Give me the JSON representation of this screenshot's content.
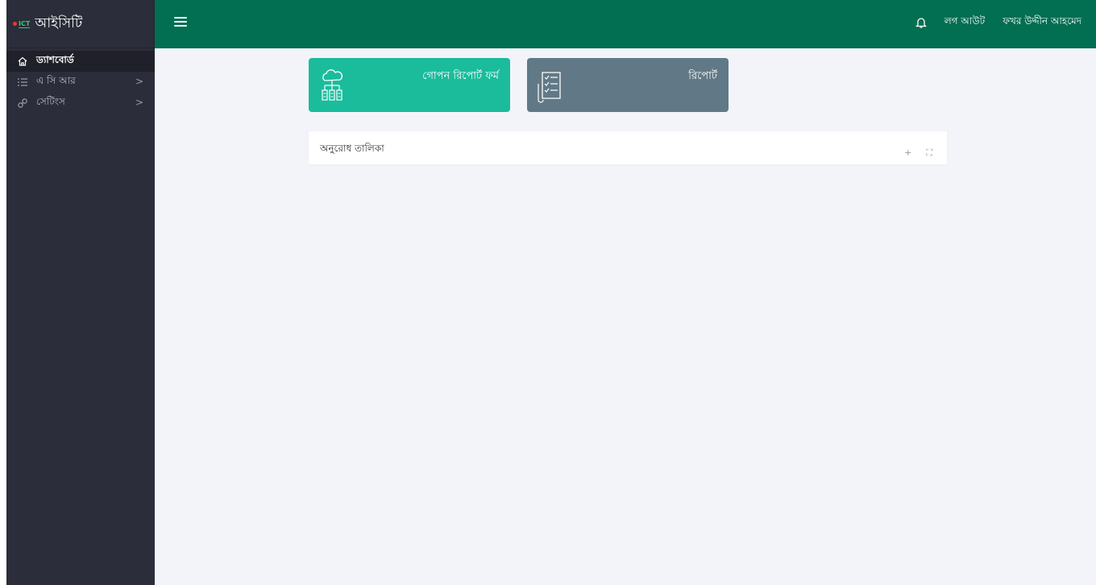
{
  "brand": {
    "logo_text": "ICT",
    "title": "আইসিটি"
  },
  "sidebar": {
    "items": [
      {
        "label": "ড্যাশবোর্ড",
        "icon": "home-icon",
        "active": true
      },
      {
        "label": "এ সি আর",
        "icon": "list-icon",
        "has_children": true
      },
      {
        "label": "সেটিংস",
        "icon": "link-icon",
        "has_children": true
      }
    ],
    "chevron": ">"
  },
  "topbar": {
    "logout_label": "লগ আউট",
    "user_name": "ফখর উদ্দীন আহমেদ"
  },
  "cards": [
    {
      "title": "গোপন রিপোর্ট ফর্ম",
      "icon": "cloud-network-icon",
      "color": "#1abc9c"
    },
    {
      "title": "রিপোর্ট",
      "icon": "checklist-icon",
      "color": "#617986"
    }
  ],
  "panel": {
    "title": "অনুরোধ তালিকা",
    "add_symbol": "+",
    "expand_symbol": "⛶"
  },
  "colors": {
    "topbar": "#026e52",
    "sidebar": "#2b2d3a",
    "content_bg": "#f3f4f9"
  }
}
